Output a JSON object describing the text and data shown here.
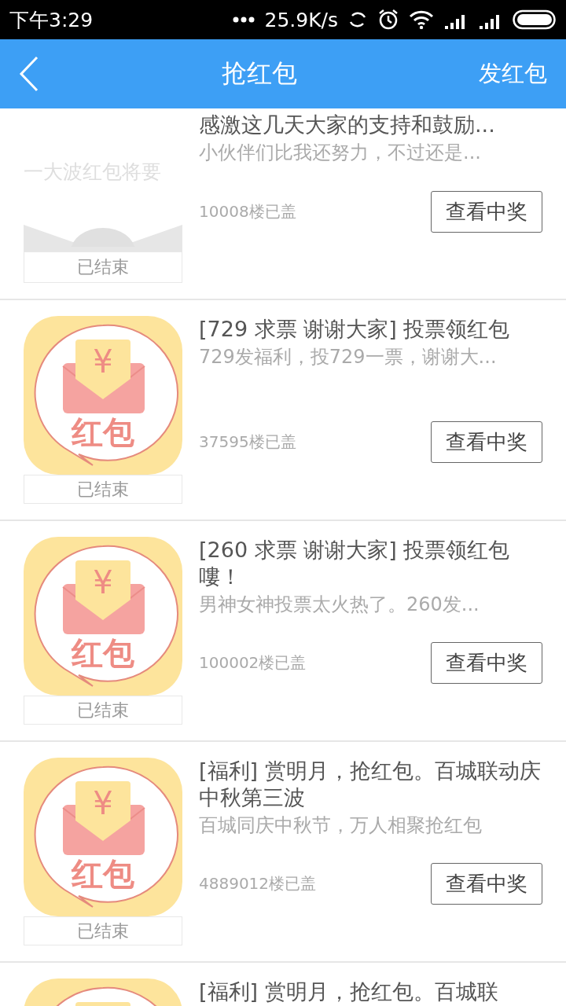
{
  "status_bar": {
    "time": "下午3:29",
    "net_speed": "25.9K/s"
  },
  "header": {
    "title": "抢红包",
    "action": "发红包"
  },
  "items": [
    {
      "image": {
        "kind": "banner",
        "text": "一大波红包将要"
      },
      "status": "已结束",
      "title": "感激这几天大家的支持和鼓励...",
      "summary": "小伙伴们比我还努力，不过还是...",
      "floors": "10008楼已盖",
      "button": "查看中奖"
    },
    {
      "image": {
        "kind": "envelope",
        "symbol": "¥",
        "caption": "红包"
      },
      "status": "已结束",
      "title": "[729 求票 谢谢大家] 投票领红包",
      "summary": "729发福利，投729一票，谢谢大...",
      "floors": "37595楼已盖",
      "button": "查看中奖"
    },
    {
      "image": {
        "kind": "envelope",
        "symbol": "¥",
        "caption": "红包"
      },
      "status": "已结束",
      "title": "[260 求票 谢谢大家] 投票领红包嘍！",
      "summary": "男神女神投票太火热了。260发...",
      "floors": "100002楼已盖",
      "button": "查看中奖"
    },
    {
      "image": {
        "kind": "envelope",
        "symbol": "¥",
        "caption": "红包"
      },
      "status": "已结束",
      "title": "[福利] 赏明月，抢红包。百城联动庆中秋第三波",
      "summary": "百城同庆中秋节，万人相聚抢红包",
      "floors": "4889012楼已盖",
      "button": "查看中奖"
    },
    {
      "image": {
        "kind": "envelope"
      },
      "title": "[福利] 赏明月，抢红包。百城联"
    }
  ]
}
